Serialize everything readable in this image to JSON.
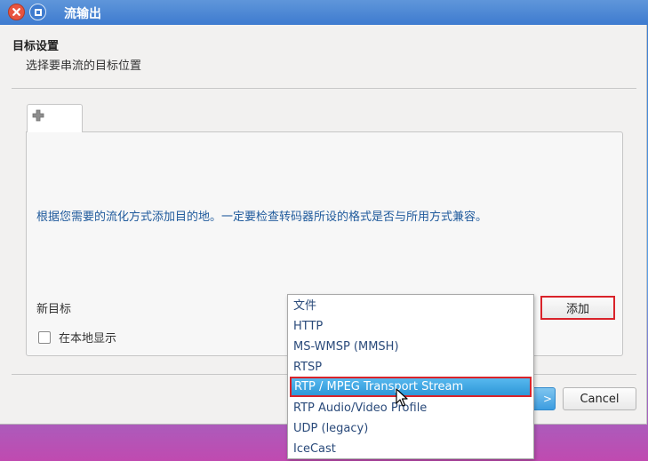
{
  "window": {
    "title": "流输出"
  },
  "header": {
    "title": "目标设置",
    "subtitle": "选择要串流的目标位置"
  },
  "tab": {
    "icon": "plus-icon"
  },
  "panel": {
    "info": "根据您需要的流化方式添加目的地。一定要检查转码器所设的格式是否与所用方式兼容。",
    "new_destination_label": "新目标",
    "add_button": "添加",
    "show_locally_label": "在本地显示",
    "show_locally_checked": false
  },
  "dropdown": {
    "items": [
      "文件",
      "HTTP",
      "MS-WMSP (MMSH)",
      "RTSP",
      "RTP / MPEG Transport Stream",
      "RTP Audio/Video Profile",
      "UDP (legacy)",
      "IceCast"
    ],
    "selected": "RTP / MPEG Transport Stream"
  },
  "buttons": {
    "next_partial": ">",
    "cancel": "Cancel"
  },
  "colors": {
    "titlebar": "#3e7bcf",
    "highlight": "#2f97d8",
    "info_text": "#1f5a9c",
    "red_outline": "#d9232a"
  }
}
